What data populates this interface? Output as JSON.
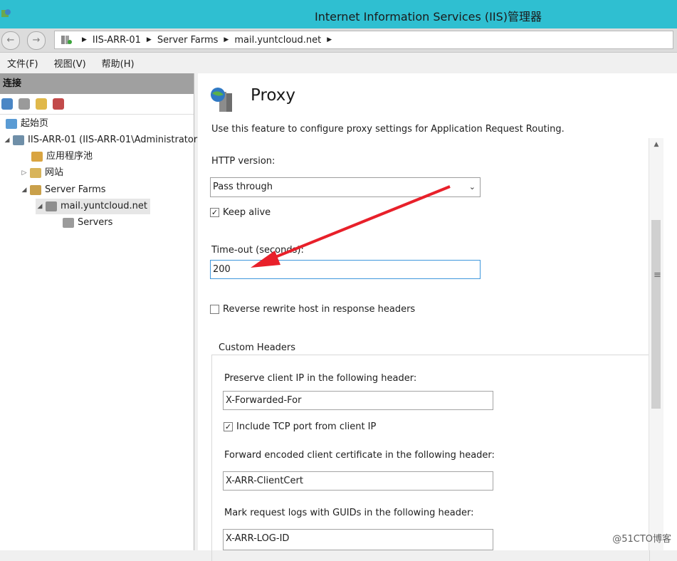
{
  "window": {
    "title": "Internet Information Services (IIS)管理器",
    "icon": "iis-app-icon"
  },
  "addressbar": {
    "back_icon": "back-arrow-icon",
    "forward_icon": "forward-arrow-icon",
    "breadcrumb": [
      "IIS-ARR-01",
      "Server Farms",
      "mail.yuntcloud.net"
    ]
  },
  "menu": {
    "items": [
      "文件(F)",
      "视图(V)",
      "帮助(H)"
    ]
  },
  "connections": {
    "header": "连接",
    "toolbar_icons": [
      "connect-icon",
      "save-icon",
      "folder-icon",
      "disconnect-icon"
    ],
    "tree": [
      {
        "label": "起始页",
        "icon": "start-page-icon"
      },
      {
        "label": "IIS-ARR-01 (IIS-ARR-01\\Administrator)",
        "icon": "server-icon"
      },
      {
        "label": "应用程序池",
        "icon": "app-pool-icon"
      },
      {
        "label": "网站",
        "icon": "sites-icon"
      },
      {
        "label": "Server Farms",
        "icon": "server-farms-icon"
      },
      {
        "label": "mail.yuntcloud.net",
        "icon": "server-farm-icon"
      },
      {
        "label": "Servers",
        "icon": "servers-icon"
      }
    ]
  },
  "proxy": {
    "title": "Proxy",
    "description": "Use this feature to configure proxy settings for Application Request Routing.",
    "http_version_label": "HTTP version:",
    "http_version_value": "Pass through",
    "keep_alive_label": "Keep alive",
    "keep_alive_checked": true,
    "timeout_label": "Time-out (seconds):",
    "timeout_value": "200",
    "reverse_rewrite_label": "Reverse rewrite host in response headers",
    "reverse_rewrite_checked": false,
    "custom_headers": {
      "title": "Custom Headers",
      "preserve_ip_label": "Preserve client IP in the following header:",
      "preserve_ip_value": "X-Forwarded-For",
      "include_tcp_label": "Include TCP port from client IP",
      "include_tcp_checked": true,
      "client_cert_label": "Forward encoded client certificate in the following header:",
      "client_cert_value": "X-ARR-ClientCert",
      "guid_label": "Mark request logs with GUIDs in the following header:",
      "guid_value": "X-ARR-LOG-ID"
    }
  },
  "watermark": "@51CTO博客",
  "colors": {
    "titlebar": "#2fbfd1",
    "annotation_arrow": "#e8202a",
    "focus_border": "#3f97dd"
  }
}
